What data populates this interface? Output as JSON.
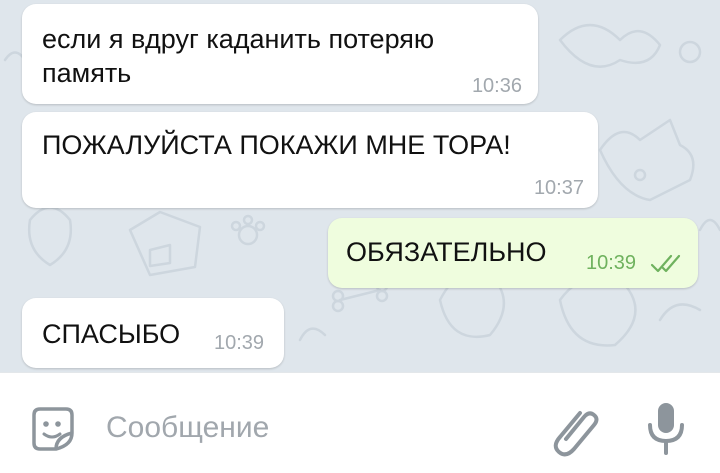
{
  "messages": [
    {
      "direction": "incoming",
      "text": "если я вдруг каданить потеряю\nпамять",
      "time": "10:36"
    },
    {
      "direction": "incoming",
      "text": "ПОЖАЛУЙСТА ПОКАЖИ МНЕ ТОРА!",
      "time": "10:37"
    },
    {
      "direction": "outgoing",
      "text": "ОБЯЗАТЕЛЬНО",
      "time": "10:39",
      "status_icon": "double-check-icon"
    },
    {
      "direction": "incoming",
      "text": "СПАСЫБО",
      "time": "10:39"
    }
  ],
  "composer": {
    "placeholder": "Сообщение",
    "value": "",
    "left_icon": "emoji-sticker-icon",
    "right_icons": [
      "paperclip-icon",
      "microphone-icon"
    ]
  },
  "colors": {
    "chat_background": "#dfe6ec",
    "incoming_bubble": "#ffffff",
    "outgoing_bubble": "#effdde",
    "outgoing_time": "#6fb25e",
    "incoming_time": "#a2a8ae",
    "icon_gray": "#8d959c"
  }
}
